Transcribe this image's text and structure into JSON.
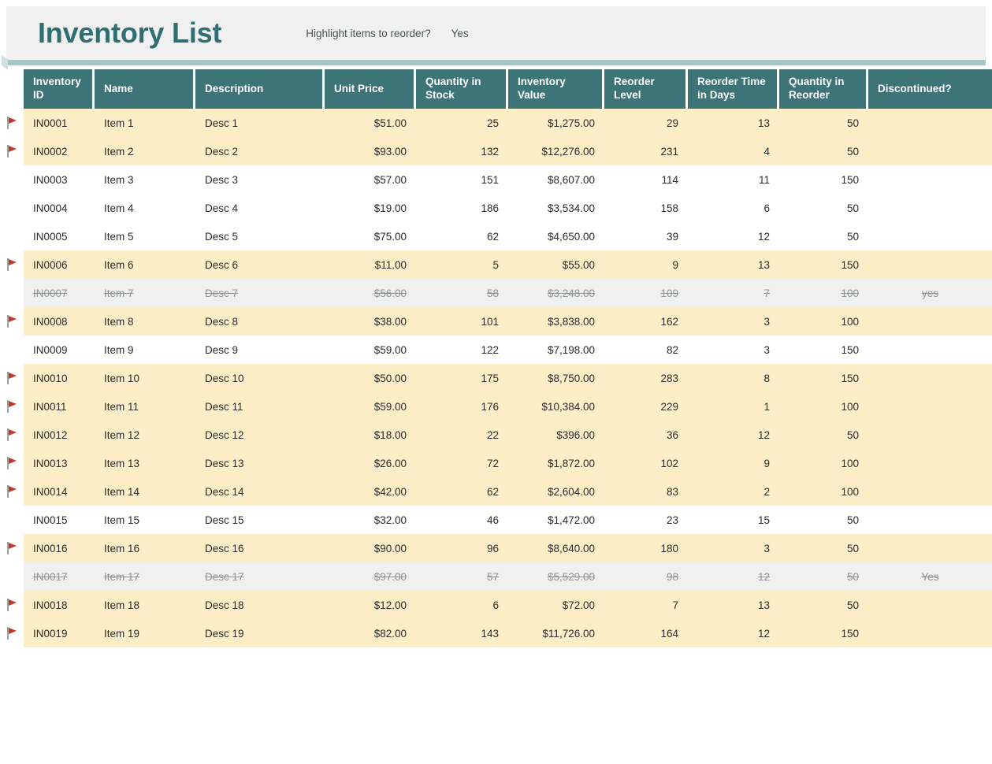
{
  "header": {
    "title": "Inventory List",
    "reorder_prompt": "Highlight items to reorder?",
    "reorder_value": "Yes"
  },
  "colors": {
    "title_text": "#2f6f73",
    "header_fill": "#3d7478",
    "highlight_row": "#fdeec8",
    "discontinued_row": "#f0f0f0",
    "flag_red": "#c0392b",
    "panel_bg": "#f0f0f0"
  },
  "table": {
    "columns": [
      {
        "key": "flag",
        "label": ""
      },
      {
        "key": "inventory_id",
        "label": "Inventory ID"
      },
      {
        "key": "name",
        "label": "Name"
      },
      {
        "key": "description",
        "label": "Description"
      },
      {
        "key": "unit_price",
        "label": "Unit Price"
      },
      {
        "key": "quantity_in_stock",
        "label": "Quantity in Stock"
      },
      {
        "key": "inventory_value",
        "label": "Inventory Value"
      },
      {
        "key": "reorder_level",
        "label": "Reorder Level"
      },
      {
        "key": "reorder_time_in_days",
        "label": "Reorder Time in Days"
      },
      {
        "key": "quantity_in_reorder",
        "label": "Quantity in Reorder"
      },
      {
        "key": "discontinued",
        "label": "Discontinued?"
      }
    ],
    "rows": [
      {
        "flag": true,
        "state": "highlight",
        "inventory_id": "IN0001",
        "name": "Item 1",
        "description": "Desc 1",
        "unit_price": "$51.00",
        "quantity_in_stock": "25",
        "inventory_value": "$1,275.00",
        "reorder_level": "29",
        "reorder_time_in_days": "13",
        "quantity_in_reorder": "50",
        "discontinued": ""
      },
      {
        "flag": true,
        "state": "highlight",
        "inventory_id": "IN0002",
        "name": "Item 2",
        "description": "Desc 2",
        "unit_price": "$93.00",
        "quantity_in_stock": "132",
        "inventory_value": "$12,276.00",
        "reorder_level": "231",
        "reorder_time_in_days": "4",
        "quantity_in_reorder": "50",
        "discontinued": ""
      },
      {
        "flag": false,
        "state": "plain",
        "inventory_id": "IN0003",
        "name": "Item 3",
        "description": "Desc 3",
        "unit_price": "$57.00",
        "quantity_in_stock": "151",
        "inventory_value": "$8,607.00",
        "reorder_level": "114",
        "reorder_time_in_days": "11",
        "quantity_in_reorder": "150",
        "discontinued": ""
      },
      {
        "flag": false,
        "state": "plain",
        "inventory_id": "IN0004",
        "name": "Item 4",
        "description": "Desc 4",
        "unit_price": "$19.00",
        "quantity_in_stock": "186",
        "inventory_value": "$3,534.00",
        "reorder_level": "158",
        "reorder_time_in_days": "6",
        "quantity_in_reorder": "50",
        "discontinued": ""
      },
      {
        "flag": false,
        "state": "plain",
        "inventory_id": "IN0005",
        "name": "Item 5",
        "description": "Desc 5",
        "unit_price": "$75.00",
        "quantity_in_stock": "62",
        "inventory_value": "$4,650.00",
        "reorder_level": "39",
        "reorder_time_in_days": "12",
        "quantity_in_reorder": "50",
        "discontinued": ""
      },
      {
        "flag": true,
        "state": "highlight",
        "inventory_id": "IN0006",
        "name": "Item 6",
        "description": "Desc 6",
        "unit_price": "$11.00",
        "quantity_in_stock": "5",
        "inventory_value": "$55.00",
        "reorder_level": "9",
        "reorder_time_in_days": "13",
        "quantity_in_reorder": "150",
        "discontinued": ""
      },
      {
        "flag": false,
        "state": "discontinued",
        "inventory_id": "IN0007",
        "name": "Item 7",
        "description": "Desc 7",
        "unit_price": "$56.00",
        "quantity_in_stock": "58",
        "inventory_value": "$3,248.00",
        "reorder_level": "109",
        "reorder_time_in_days": "7",
        "quantity_in_reorder": "100",
        "discontinued": "yes"
      },
      {
        "flag": true,
        "state": "highlight",
        "inventory_id": "IN0008",
        "name": "Item 8",
        "description": "Desc 8",
        "unit_price": "$38.00",
        "quantity_in_stock": "101",
        "inventory_value": "$3,838.00",
        "reorder_level": "162",
        "reorder_time_in_days": "3",
        "quantity_in_reorder": "100",
        "discontinued": ""
      },
      {
        "flag": false,
        "state": "plain",
        "inventory_id": "IN0009",
        "name": "Item 9",
        "description": "Desc 9",
        "unit_price": "$59.00",
        "quantity_in_stock": "122",
        "inventory_value": "$7,198.00",
        "reorder_level": "82",
        "reorder_time_in_days": "3",
        "quantity_in_reorder": "150",
        "discontinued": ""
      },
      {
        "flag": true,
        "state": "highlight",
        "inventory_id": "IN0010",
        "name": "Item 10",
        "description": "Desc 10",
        "unit_price": "$50.00",
        "quantity_in_stock": "175",
        "inventory_value": "$8,750.00",
        "reorder_level": "283",
        "reorder_time_in_days": "8",
        "quantity_in_reorder": "150",
        "discontinued": ""
      },
      {
        "flag": true,
        "state": "highlight",
        "inventory_id": "IN0011",
        "name": "Item 11",
        "description": "Desc 11",
        "unit_price": "$59.00",
        "quantity_in_stock": "176",
        "inventory_value": "$10,384.00",
        "reorder_level": "229",
        "reorder_time_in_days": "1",
        "quantity_in_reorder": "100",
        "discontinued": ""
      },
      {
        "flag": true,
        "state": "highlight",
        "inventory_id": "IN0012",
        "name": "Item 12",
        "description": "Desc 12",
        "unit_price": "$18.00",
        "quantity_in_stock": "22",
        "inventory_value": "$396.00",
        "reorder_level": "36",
        "reorder_time_in_days": "12",
        "quantity_in_reorder": "50",
        "discontinued": ""
      },
      {
        "flag": true,
        "state": "highlight",
        "inventory_id": "IN0013",
        "name": "Item 13",
        "description": "Desc 13",
        "unit_price": "$26.00",
        "quantity_in_stock": "72",
        "inventory_value": "$1,872.00",
        "reorder_level": "102",
        "reorder_time_in_days": "9",
        "quantity_in_reorder": "100",
        "discontinued": ""
      },
      {
        "flag": true,
        "state": "highlight",
        "inventory_id": "IN0014",
        "name": "Item 14",
        "description": "Desc 14",
        "unit_price": "$42.00",
        "quantity_in_stock": "62",
        "inventory_value": "$2,604.00",
        "reorder_level": "83",
        "reorder_time_in_days": "2",
        "quantity_in_reorder": "100",
        "discontinued": ""
      },
      {
        "flag": false,
        "state": "plain",
        "inventory_id": "IN0015",
        "name": "Item 15",
        "description": "Desc 15",
        "unit_price": "$32.00",
        "quantity_in_stock": "46",
        "inventory_value": "$1,472.00",
        "reorder_level": "23",
        "reorder_time_in_days": "15",
        "quantity_in_reorder": "50",
        "discontinued": ""
      },
      {
        "flag": true,
        "state": "highlight",
        "inventory_id": "IN0016",
        "name": "Item 16",
        "description": "Desc 16",
        "unit_price": "$90.00",
        "quantity_in_stock": "96",
        "inventory_value": "$8,640.00",
        "reorder_level": "180",
        "reorder_time_in_days": "3",
        "quantity_in_reorder": "50",
        "discontinued": ""
      },
      {
        "flag": false,
        "state": "discontinued",
        "inventory_id": "IN0017",
        "name": "Item 17",
        "description": "Desc 17",
        "unit_price": "$97.00",
        "quantity_in_stock": "57",
        "inventory_value": "$5,529.00",
        "reorder_level": "98",
        "reorder_time_in_days": "12",
        "quantity_in_reorder": "50",
        "discontinued": "Yes"
      },
      {
        "flag": true,
        "state": "highlight",
        "inventory_id": "IN0018",
        "name": "Item 18",
        "description": "Desc 18",
        "unit_price": "$12.00",
        "quantity_in_stock": "6",
        "inventory_value": "$72.00",
        "reorder_level": "7",
        "reorder_time_in_days": "13",
        "quantity_in_reorder": "50",
        "discontinued": ""
      },
      {
        "flag": true,
        "state": "highlight",
        "inventory_id": "IN0019",
        "name": "Item 19",
        "description": "Desc 19",
        "unit_price": "$82.00",
        "quantity_in_stock": "143",
        "inventory_value": "$11,726.00",
        "reorder_level": "164",
        "reorder_time_in_days": "12",
        "quantity_in_reorder": "150",
        "discontinued": ""
      }
    ]
  },
  "icons": {
    "reorder_flag": "flag-icon"
  }
}
